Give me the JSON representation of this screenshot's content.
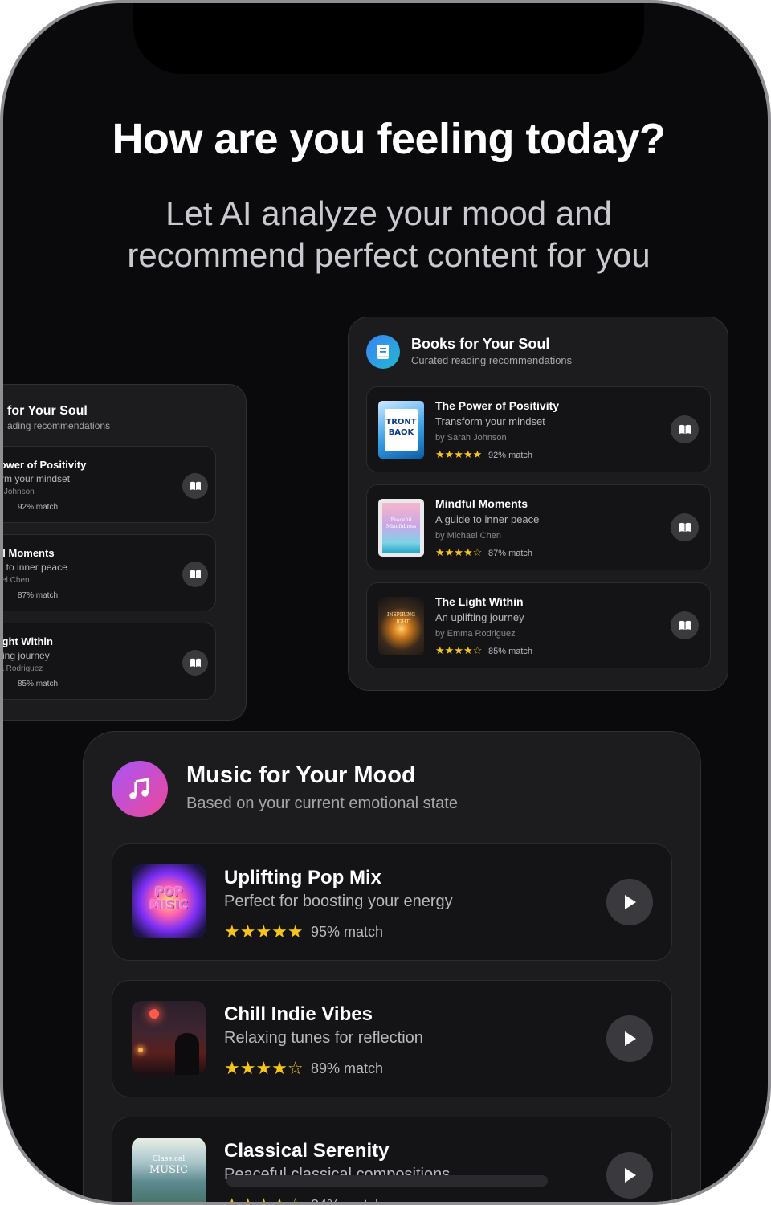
{
  "header": {
    "title": "How are you feeling today?",
    "subtitle_line1": "Let AI analyze your mood and",
    "subtitle_line2": "recommend perfect content for you"
  },
  "left_card": {
    "title": "for Your Soul",
    "subtitle": "ading recommendations",
    "items": [
      {
        "title": "Power of Positivity",
        "desc": "form your mindset",
        "author": "ah Johnson",
        "stars": "★★",
        "match": "92% match"
      },
      {
        "title": "ful Moments",
        "desc": "de to inner peace",
        "author": "hael Chen",
        "stars": "★☆",
        "match": "87% match"
      },
      {
        "title": "Light Within",
        "desc": "lifting journey",
        "author": "ma Rodriguez",
        "stars": "★☆",
        "match": "85% match"
      }
    ]
  },
  "books": {
    "title": "Books for Your Soul",
    "subtitle": "Curated reading recommendations",
    "icon": "book-icon",
    "items": [
      {
        "title": "The Power of Positivity",
        "desc": "Transform your mindset",
        "author": "by Sarah Johnson",
        "stars": "★★★★★",
        "rating": 5,
        "match": "92% match",
        "cover_text_1": "TRONT",
        "cover_text_2": "BAOK"
      },
      {
        "title": "Mindful Moments",
        "desc": "A guide to inner peace",
        "author": "by Michael Chen",
        "stars": "★★★★☆",
        "rating": 4,
        "match": "87% match",
        "cover_text_1": "Peaceful",
        "cover_text_2": "Mindfulness"
      },
      {
        "title": "The Light Within",
        "desc": "An uplifting journey",
        "author": "by Emma Rodriguez",
        "stars": "★★★★☆",
        "rating": 4,
        "match": "85% match",
        "cover_text_1": "INSPIRING",
        "cover_text_2": "LIGHT"
      }
    ]
  },
  "music": {
    "title": "Music for Your Mood",
    "subtitle": "Based on your current emotional state",
    "icon": "music-note-icon",
    "items": [
      {
        "title": "Uplifting Pop Mix",
        "desc": "Perfect for boosting your energy",
        "stars": "★★★★★",
        "rating": 5,
        "match": "95% match",
        "cover_text_1": "POP",
        "cover_text_2": "MISIC"
      },
      {
        "title": "Chill Indie Vibes",
        "desc": "Relaxing tunes for reflection",
        "stars": "★★★★☆",
        "rating": 4,
        "match": "89% match"
      },
      {
        "title": "Classical Serenity",
        "desc": "Peaceful classical compositions",
        "stars": "★★★★☆",
        "rating": 4,
        "match": "84% match",
        "cover_text_1": "Classical",
        "cover_text_2": "MUSIC"
      }
    ]
  },
  "colors": {
    "background": "#0a0a0c",
    "card": "#1c1c1f",
    "star": "#f5c518",
    "music_accent": "#a855f7",
    "book_accent": "#3b82f6"
  }
}
